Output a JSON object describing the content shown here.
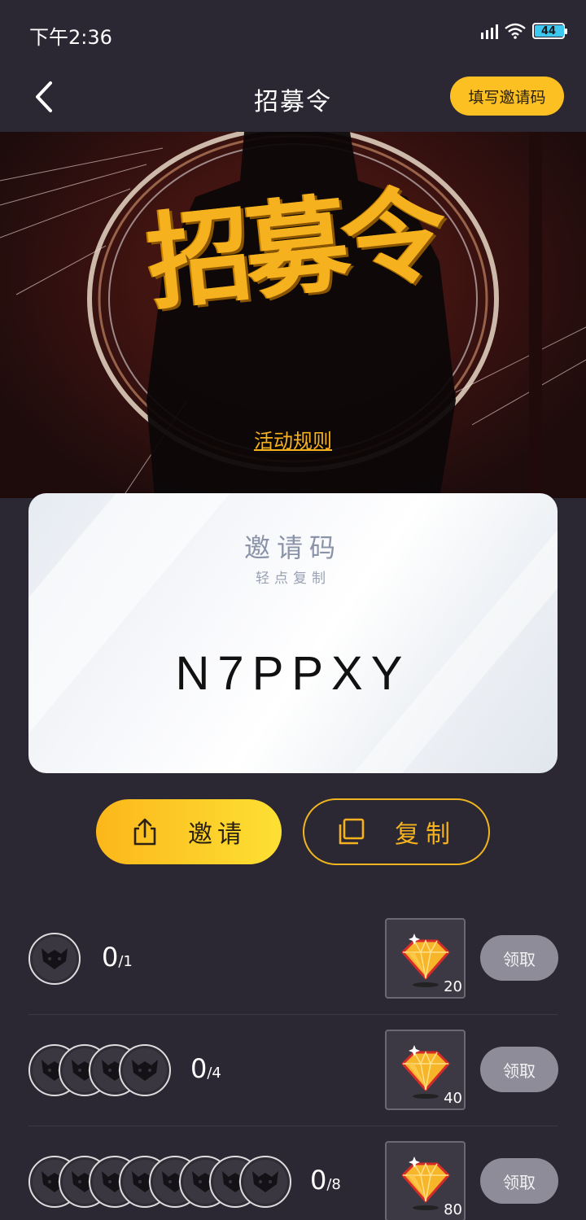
{
  "status_bar": {
    "time": "下午2:36",
    "battery": "44"
  },
  "nav": {
    "title": "招募令",
    "invite_code_button": "填写邀请码"
  },
  "banner": {
    "title": "招募令",
    "rules_link": "活动规则"
  },
  "code_card": {
    "label": "邀请码",
    "hint": "轻点复制",
    "code": "N7PPXY"
  },
  "actions": {
    "invite_label": "邀请",
    "copy_label": "复制"
  },
  "colors": {
    "accent": "#fcc022",
    "background": "#2b2833",
    "claim_disabled": "#8e8c98"
  },
  "rewards": [
    {
      "progress": "0",
      "target": "/1",
      "amount": "20",
      "claim_label": "领取",
      "avatar_count": 1
    },
    {
      "progress": "0",
      "target": "/4",
      "amount": "40",
      "claim_label": "领取",
      "avatar_count": 4
    },
    {
      "progress": "0",
      "target": "/8",
      "amount": "80",
      "claim_label": "领取",
      "avatar_count": 8
    }
  ]
}
